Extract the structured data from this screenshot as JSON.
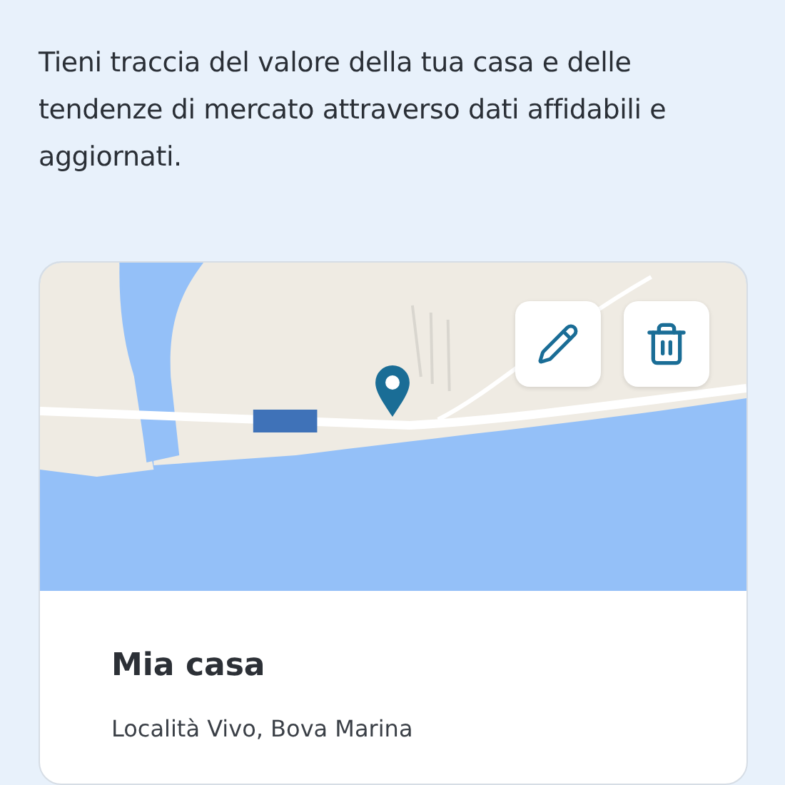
{
  "intro": "Tieni traccia del valore della tua casa e delle tendenze di mercato attraverso dati affidabili e aggiornati.",
  "property": {
    "actions": [
      {
        "kind": "edit"
      },
      {
        "kind": "delete"
      }
    ],
    "title": "Mia casa",
    "address": "Località Vivo, Bova Marina"
  }
}
